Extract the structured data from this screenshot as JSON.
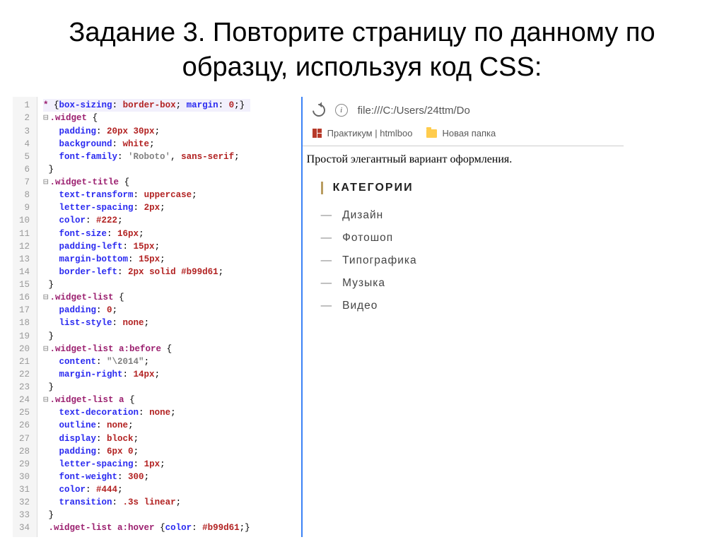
{
  "slide_title": "Задание 3. Повторите страницу по данному по образцу, используя код CSS:",
  "code_lines": [
    {
      "n": 1,
      "html": "<span class='sel'>*</span> <span class='punc'>{</span><span class='prop'>box-sizing</span><span class='punc'>: </span><span class='val'>border-box</span><span class='punc'>; </span><span class='prop'>margin</span><span class='punc'>: </span><span class='num'>0</span><span class='punc'>;}</span>",
      "cls": "line1"
    },
    {
      "n": 2,
      "html": "<span class='fold'>⊟</span><span class='sel'>.widget</span> <span class='punc'>{</span>"
    },
    {
      "n": 3,
      "html": "   <span class='prop'>padding</span><span class='punc'>: </span><span class='num'>20px 30px</span><span class='punc'>;</span>"
    },
    {
      "n": 4,
      "html": "   <span class='prop'>background</span><span class='punc'>: </span><span class='val'>white</span><span class='punc'>;</span>"
    },
    {
      "n": 5,
      "html": "   <span class='prop'>font-family</span><span class='punc'>: </span><span class='str'>'Roboto'</span><span class='punc'>, </span><span class='val'>sans-serif</span><span class='punc'>;</span>"
    },
    {
      "n": 6,
      "html": " <span class='punc'>}</span>"
    },
    {
      "n": 7,
      "html": "<span class='fold'>⊟</span><span class='sel'>.widget-title</span> <span class='punc'>{</span>"
    },
    {
      "n": 8,
      "html": "   <span class='prop'>text-transform</span><span class='punc'>: </span><span class='val'>uppercase</span><span class='punc'>;</span>"
    },
    {
      "n": 9,
      "html": "   <span class='prop'>letter-spacing</span><span class='punc'>: </span><span class='num'>2px</span><span class='punc'>;</span>"
    },
    {
      "n": 10,
      "html": "   <span class='prop'>color</span><span class='punc'>: </span><span class='num'>#222</span><span class='punc'>;</span>"
    },
    {
      "n": 11,
      "html": "   <span class='prop'>font-size</span><span class='punc'>: </span><span class='num'>16px</span><span class='punc'>;</span>"
    },
    {
      "n": 12,
      "html": "   <span class='prop'>padding-left</span><span class='punc'>: </span><span class='num'>15px</span><span class='punc'>;</span>"
    },
    {
      "n": 13,
      "html": "   <span class='prop'>margin-bottom</span><span class='punc'>: </span><span class='num'>15px</span><span class='punc'>;</span>"
    },
    {
      "n": 14,
      "html": "   <span class='prop'>border-left</span><span class='punc'>: </span><span class='num'>2px</span> <span class='val'>solid</span> <span class='num'>#b99d61</span><span class='punc'>;</span>"
    },
    {
      "n": 15,
      "html": " <span class='punc'>}</span>"
    },
    {
      "n": 16,
      "html": "<span class='fold'>⊟</span><span class='sel'>.widget-list</span> <span class='punc'>{</span>"
    },
    {
      "n": 17,
      "html": "   <span class='prop'>padding</span><span class='punc'>: </span><span class='num'>0</span><span class='punc'>;</span>"
    },
    {
      "n": 18,
      "html": "   <span class='prop'>list-style</span><span class='punc'>: </span><span class='val'>none</span><span class='punc'>;</span>"
    },
    {
      "n": 19,
      "html": " <span class='punc'>}</span>"
    },
    {
      "n": 20,
      "html": "<span class='fold'>⊟</span><span class='sel'>.widget-list a:before</span> <span class='punc'>{</span>"
    },
    {
      "n": 21,
      "html": "   <span class='prop'>content</span><span class='punc'>: </span><span class='str'>\"\\2014\"</span><span class='punc'>;</span>"
    },
    {
      "n": 22,
      "html": "   <span class='prop'>margin-right</span><span class='punc'>: </span><span class='num'>14px</span><span class='punc'>;</span>"
    },
    {
      "n": 23,
      "html": " <span class='punc'>}</span>"
    },
    {
      "n": 24,
      "html": "<span class='fold'>⊟</span><span class='sel'>.widget-list a</span> <span class='punc'>{</span>"
    },
    {
      "n": 25,
      "html": "   <span class='prop'>text-decoration</span><span class='punc'>: </span><span class='val'>none</span><span class='punc'>;</span>"
    },
    {
      "n": 26,
      "html": "   <span class='prop'>outline</span><span class='punc'>: </span><span class='val'>none</span><span class='punc'>;</span>"
    },
    {
      "n": 27,
      "html": "   <span class='prop'>display</span><span class='punc'>: </span><span class='val'>block</span><span class='punc'>;</span>"
    },
    {
      "n": 28,
      "html": "   <span class='prop'>padding</span><span class='punc'>: </span><span class='num'>6px 0</span><span class='punc'>;</span>"
    },
    {
      "n": 29,
      "html": "   <span class='prop'>letter-spacing</span><span class='punc'>: </span><span class='num'>1px</span><span class='punc'>;</span>"
    },
    {
      "n": 30,
      "html": "   <span class='prop'>font-weight</span><span class='punc'>: </span><span class='num'>300</span><span class='punc'>;</span>"
    },
    {
      "n": 31,
      "html": "   <span class='prop'>color</span><span class='punc'>: </span><span class='num'>#444</span><span class='punc'>;</span>"
    },
    {
      "n": 32,
      "html": "   <span class='prop'>transition</span><span class='punc'>: </span><span class='num'>.3s</span> <span class='val'>linear</span><span class='punc'>;</span>"
    },
    {
      "n": 33,
      "html": " <span class='punc'>}</span>"
    },
    {
      "n": 34,
      "html": " <span class='sel'>.widget-list a:hover</span> <span class='punc'>{</span><span class='prop'>color</span><span class='punc'>: </span><span class='num'>#b99d61</span><span class='punc'>;}</span>"
    }
  ],
  "browser": {
    "url": "file:///C:/Users/24ttm/Do",
    "bookmarks": [
      {
        "label": "Практикум | htmlboo"
      },
      {
        "label": "Новая папка"
      }
    ],
    "page_text": "Простой элегантный вариант оформления.",
    "widget_title": "Категории",
    "categories": [
      "Дизайн",
      "Фотошоп",
      "Типографика",
      "Музыка",
      "Видео"
    ]
  }
}
